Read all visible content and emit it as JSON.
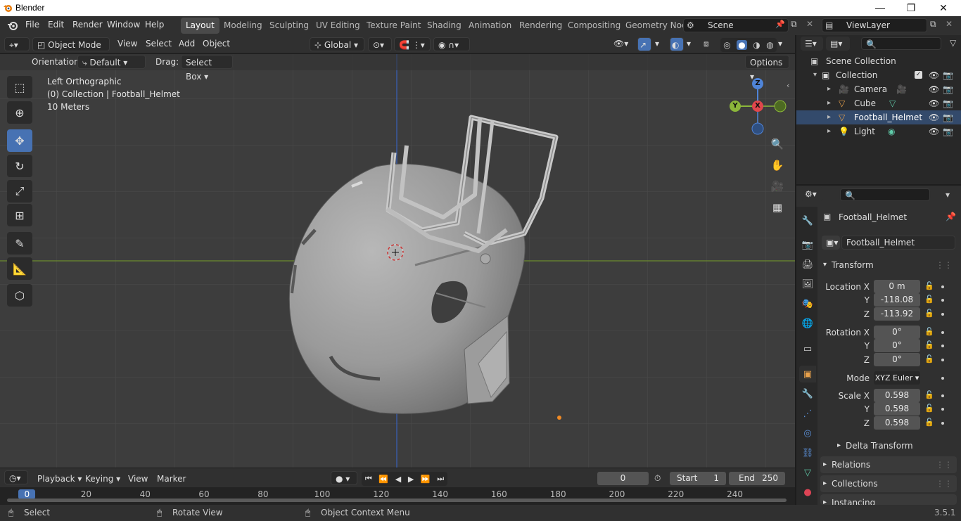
{
  "window": {
    "title": "Blender",
    "minimize": "—",
    "restore": "❐",
    "close": "✕"
  },
  "menu": [
    "File",
    "Edit",
    "Render",
    "Window",
    "Help"
  ],
  "workspaces": [
    "Layout",
    "Modeling",
    "Sculpting",
    "UV Editing",
    "Texture Paint",
    "Shading",
    "Animation",
    "Rendering",
    "Compositing",
    "Geometry Noc"
  ],
  "scene": "Scene",
  "view_layer": "ViewLayer",
  "viewport_header": {
    "mode": "Object Mode",
    "menus": [
      "View",
      "Select",
      "Add",
      "Object"
    ],
    "transform_orientation": "Global",
    "options": "Options"
  },
  "tool_options": {
    "orientation_label": "Orientation:",
    "orientation_value": "Default",
    "drag_label": "Drag:",
    "drag_value": "Select Box"
  },
  "viewport_overlay": {
    "view_name": "Left Orthographic",
    "collection_info": "(0) Collection | Football_Helmet",
    "scale": "10 Meters"
  },
  "gizmo": {
    "z": "Z",
    "y": "Y",
    "x": "X"
  },
  "outliner": {
    "root": "Scene Collection",
    "collection": "Collection",
    "items": [
      "Camera",
      "Cube",
      "Football_Helmet",
      "Light"
    ]
  },
  "properties": {
    "object_name": "Football_Helmet",
    "datablock": "Football_Helmet",
    "transform_header": "Transform",
    "location": {
      "label": "Location X",
      "x": "0 m",
      "y": "-118.08",
      "z": "-113.92"
    },
    "rotation": {
      "label": "Rotation X",
      "x": "0°",
      "y": "0°",
      "z": "0°"
    },
    "mode_label": "Mode",
    "mode_value": "XYZ Euler",
    "scale": {
      "label": "Scale X",
      "x": "0.598",
      "y": "0.598",
      "z": "0.598"
    },
    "axis_y": "Y",
    "axis_z": "Z",
    "subpanels": [
      "Delta Transform",
      "Relations",
      "Collections",
      "Instancing"
    ]
  },
  "timeline": {
    "menus": [
      "Playback",
      "Keying",
      "View",
      "Marker"
    ],
    "current_frame": "0",
    "start_label": "Start",
    "start": "1",
    "end_label": "End",
    "end": "250",
    "ruler_ticks": [
      "0",
      "20",
      "40",
      "60",
      "80",
      "100",
      "120",
      "140",
      "160",
      "180",
      "200",
      "220",
      "240"
    ]
  },
  "statusbar": {
    "select": "Select",
    "rotate": "Rotate View",
    "context": "Object Context Menu",
    "version": "3.5.1"
  }
}
